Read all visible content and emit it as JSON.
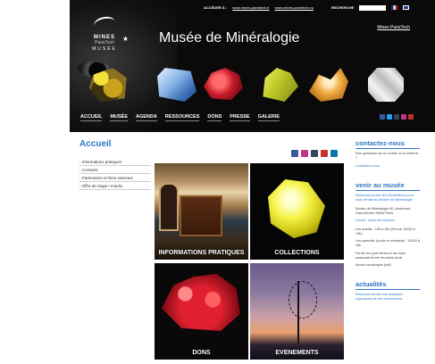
{
  "header": {
    "topbar": {
      "access_label": "ACCÉDER À :",
      "links": [
        "www.mines-paristech.fr",
        "www.mines-paristech.eu"
      ],
      "search_label": "RECHERCHE"
    },
    "logo": {
      "line1": "MINES",
      "line2": "ParisTech",
      "line3": "MUSÉE"
    },
    "site_title": "Musée de Minéralogie",
    "external_link": "Mines ParisTech",
    "nav": [
      "ACCUEIL",
      "MUSÉE",
      "AGENDA",
      "RESSOURCES",
      "DONS",
      "PRESSE",
      "GALERIE"
    ]
  },
  "main": {
    "page_title": "Accueil",
    "subnav": [
      "Informations pratiques",
      "Contacts",
      "Partenaires et liens externes",
      "Offre de stage / emploi"
    ],
    "tiles": [
      {
        "label": "INFORMATIONS PRATIQUES"
      },
      {
        "label": "COLLECTIONS"
      },
      {
        "label": "DONS"
      },
      {
        "label": "EVENEMENTS"
      }
    ]
  },
  "sidebar": {
    "contact": {
      "heading": "contactez-nous",
      "text": "Des questions sur le musée ou le minéral ?",
      "link": "Contactez-nous"
    },
    "visit": {
      "heading": "venir au musée",
      "text1": "Retrouvez toutes les informations pour vous rendre au Musée de Minéralogie",
      "address": "Musée de Minéralogie 60, boulevard Saint-Michel 75006 Paris",
      "link1": "Ouvert : Avoir les horaires",
      "hours": "Les mardis : 13h à 18h (Ferme 12h30 à 14h)",
      "text2": "Les samedis, jeudis et vendredis : 13h30 à 18h",
      "text3": "Fermé les jours fériés et les mois ensuivant fermé les week-ends",
      "link2": "Accès handicapés (pdf)"
    },
    "news": {
      "heading": "actualités",
      "text": "Retrouvez toutes nos actualités regroupées et nos événements"
    }
  },
  "colors": {
    "accent": "#2d78c8",
    "header_bg": "#0a0a0a",
    "facebook": "#3b5998",
    "instagram": "#c1358b",
    "tumblr": "#35465c",
    "youtube": "#c4302b",
    "linkedin": "#0e76a8"
  },
  "icons": [
    "facebook-icon",
    "instagram-icon",
    "tumblr-icon",
    "youtube-icon",
    "linkedin-icon",
    "star-icon"
  ]
}
